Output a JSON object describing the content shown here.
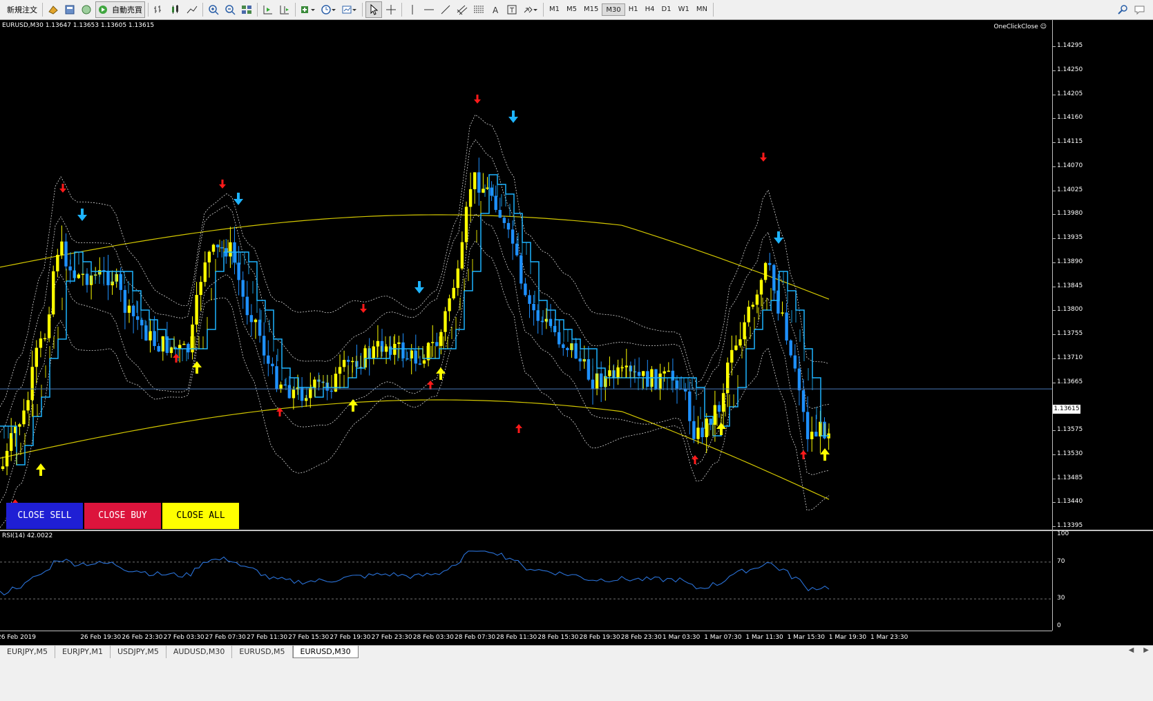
{
  "toolbar": {
    "new_order": "新規注文",
    "auto_trade": "自動売買",
    "timeframes": [
      "M1",
      "M5",
      "M15",
      "M30",
      "H1",
      "H4",
      "D1",
      "W1",
      "MN"
    ],
    "active_timeframe": "M30"
  },
  "chart": {
    "symbol_header": "EURUSD,M30  1.13647 1.13653 1.13605 1.13615",
    "oneclick_label": "OneClickClose",
    "current_price": "1.13615",
    "price_labels": [
      "1.14295",
      "1.14250",
      "1.14205",
      "1.14160",
      "1.14115",
      "1.14070",
      "1.14025",
      "1.13980",
      "1.13935",
      "1.13890",
      "1.13845",
      "1.13800",
      "1.13755",
      "1.13710",
      "1.13665",
      "1.13575",
      "1.13530",
      "1.13485",
      "1.13440",
      "1.13395"
    ],
    "buttons": {
      "close_sell": "CLOSE SELL",
      "close_buy": "CLOSE BUY",
      "close_all": "CLOSE ALL"
    },
    "colors": {
      "bull": "#ffff00",
      "bear": "#1e90ff",
      "signal_down": "#1eb4ff",
      "signal_up": "#ffff00",
      "arrow_red": "#ff1a1a",
      "band": "#ffffff",
      "envelope": "#d4c800",
      "price_line": "#4a7ab8"
    }
  },
  "rsi": {
    "label": "RSI(14) 42.0022",
    "levels": [
      "100",
      "70",
      "30",
      "0"
    ],
    "line_color": "#2a72d8"
  },
  "time_axis": [
    "26 Feb 2019",
    "26 Feb 19:30",
    "26 Feb 23:30",
    "27 Feb 03:30",
    "27 Feb 07:30",
    "27 Feb 11:30",
    "27 Feb 15:30",
    "27 Feb 19:30",
    "27 Feb 23:30",
    "28 Feb 03:30",
    "28 Feb 07:30",
    "28 Feb 11:30",
    "28 Feb 15:30",
    "28 Feb 19:30",
    "28 Feb 23:30",
    "1 Mar 03:30",
    "1 Mar 07:30",
    "1 Mar 11:30",
    "1 Mar 15:30",
    "1 Mar 19:30",
    "1 Mar 23:30"
  ],
  "tabs": [
    "EURJPY,M5",
    "EURJPY,M1",
    "USDJPY,M5",
    "AUDUSD,M30",
    "EURUSD,M5",
    "EURUSD,M30"
  ],
  "active_tab": "EURUSD,M30"
}
